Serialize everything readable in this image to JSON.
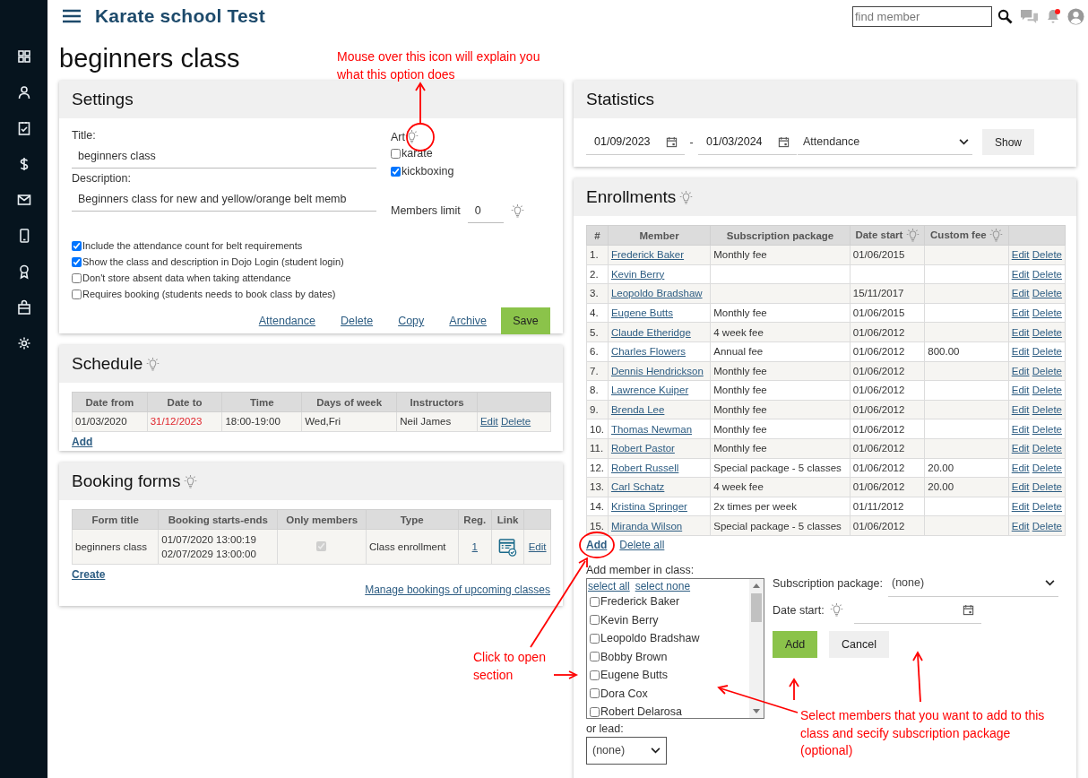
{
  "app": {
    "title": "Karate school Test",
    "search": {
      "placeholder": "find member"
    },
    "unread_notifications": true
  },
  "page_title": "beginners class",
  "settings": {
    "header": "Settings",
    "title_label": "Title:",
    "title_value": "beginners class",
    "description_label": "Description:",
    "description_value": "Beginners class for new and yellow/orange belt memb",
    "art_label": "Art",
    "art_hint": true,
    "arts": [
      {
        "label": "karate",
        "checked": false
      },
      {
        "label": "kickboxing",
        "checked": true
      }
    ],
    "members_limit_label": "Members limit",
    "members_limit_value": "0",
    "members_limit_hint": true,
    "options": [
      {
        "label": "Include the attendance count for belt requirements",
        "checked": true
      },
      {
        "label": "Show the class and description in Dojo Login (student login)",
        "checked": true
      },
      {
        "label": "Don't store absent data when taking attendance",
        "checked": false
      },
      {
        "label": "Requires booking (students needs to book class by dates)",
        "checked": false
      }
    ],
    "links": [
      "Attendance",
      "Delete",
      "Copy",
      "Archive"
    ],
    "save": "Save"
  },
  "schedule": {
    "header": "Schedule",
    "hint": true,
    "columns": [
      "Date from",
      "Date to",
      "Time",
      "Days of week",
      "Instructors"
    ],
    "rows": [
      {
        "date_from": "01/03/2020",
        "date_to": "31/12/2023",
        "date_to_expired": true,
        "time": "18:00-19:00",
        "days": "Wed,Fri",
        "instructors": "Neil James",
        "actions": [
          "Edit",
          "Delete"
        ]
      }
    ],
    "add": "Add"
  },
  "booking_forms": {
    "header": "Booking forms",
    "hint": true,
    "columns": [
      "Form title",
      "Booking starts-ends",
      "Only members",
      "Type",
      "Reg.",
      "Link"
    ],
    "rows": [
      {
        "form_title": "beginners class",
        "starts": "01/07/2020 13:00:19",
        "ends": "02/07/2029 13:00:00",
        "only_members": {
          "checked": true,
          "disabled": true
        },
        "type": "Class enrollment",
        "reg": "1",
        "actions": [
          "Edit"
        ]
      }
    ],
    "create": "Create",
    "manage": "Manage bookings of upcoming classes"
  },
  "statistics": {
    "header": "Statistics",
    "date_from": "01/09/2023",
    "separator": "-",
    "date_to": "01/03/2024",
    "report": "Attendance",
    "show": "Show"
  },
  "enrollments": {
    "header": "Enrollments",
    "hint": true,
    "columns": [
      {
        "label": "#"
      },
      {
        "label": "Member"
      },
      {
        "label": "Subscription package"
      },
      {
        "label": "Date start",
        "hint": true
      },
      {
        "label": "Custom fee",
        "hint": true
      }
    ],
    "rows": [
      {
        "n": "1.",
        "member": "Frederick Baker",
        "package": "Monthly fee",
        "date_start": "01/06/2015",
        "actions": [
          "Edit",
          "Delete"
        ]
      },
      {
        "n": "2.",
        "member": "Kevin Berry",
        "actions": [
          "Edit",
          "Delete"
        ]
      },
      {
        "n": "3.",
        "member": "Leopoldo Bradshaw",
        "date_start": "15/11/2017",
        "actions": [
          "Edit",
          "Delete"
        ]
      },
      {
        "n": "4.",
        "member": "Eugene Butts",
        "package": "Monthly fee",
        "date_start": "01/06/2015",
        "actions": [
          "Edit",
          "Delete"
        ]
      },
      {
        "n": "5.",
        "member": "Claude Etheridge",
        "package": "4 week fee",
        "date_start": "01/06/2012",
        "actions": [
          "Edit",
          "Delete"
        ]
      },
      {
        "n": "6.",
        "member": "Charles Flowers",
        "package": "Annual fee",
        "date_start": "01/06/2012",
        "custom_fee": "800.00",
        "actions": [
          "Edit",
          "Delete"
        ]
      },
      {
        "n": "7.",
        "member": "Dennis Hendrickson",
        "package": "Monthly fee",
        "date_start": "01/06/2012",
        "actions": [
          "Edit",
          "Delete"
        ]
      },
      {
        "n": "8.",
        "member": "Lawrence Kuiper",
        "package": "Monthly fee",
        "date_start": "01/06/2012",
        "actions": [
          "Edit",
          "Delete"
        ]
      },
      {
        "n": "9.",
        "member": "Brenda Lee",
        "package": "Monthly fee",
        "date_start": "01/06/2012",
        "actions": [
          "Edit",
          "Delete"
        ]
      },
      {
        "n": "10.",
        "member": "Thomas Newman",
        "package": "Monthly fee",
        "date_start": "01/06/2012",
        "actions": [
          "Edit",
          "Delete"
        ]
      },
      {
        "n": "11.",
        "member": "Robert Pastor",
        "package": "Monthly fee",
        "date_start": "01/06/2012",
        "actions": [
          "Edit",
          "Delete"
        ]
      },
      {
        "n": "12.",
        "member": "Robert Russell",
        "package": "Special package - 5 classes",
        "date_start": "01/06/2012",
        "custom_fee": "20.00",
        "actions": [
          "Edit",
          "Delete"
        ]
      },
      {
        "n": "13.",
        "member": "Carl Schatz",
        "package": "4 week fee",
        "date_start": "01/06/2012",
        "custom_fee": "20.00",
        "actions": [
          "Edit",
          "Delete"
        ]
      },
      {
        "n": "14.",
        "member": "Kristina Springer",
        "package": "2x times per week",
        "date_start": "01/11/2012",
        "actions": [
          "Edit",
          "Delete"
        ]
      },
      {
        "n": "15.",
        "member": "Miranda Wilson",
        "package": "Special package - 5 classes",
        "date_start": "01/06/2012",
        "actions": [
          "Edit",
          "Delete"
        ]
      }
    ],
    "add": "Add",
    "delete_all": "Delete all",
    "add_form": {
      "label": "Add member in class:",
      "select_all": "select all",
      "select_none": "select none",
      "members": [
        {
          "name": "Frederick Baker",
          "checked": false
        },
        {
          "name": "Kevin Berry",
          "checked": false
        },
        {
          "name": "Leopoldo Bradshaw",
          "checked": false
        },
        {
          "name": "Bobby Brown",
          "checked": false
        },
        {
          "name": "Eugene Butts",
          "checked": false
        },
        {
          "name": "Dora Cox",
          "checked": false
        },
        {
          "name": "Robert Delarosa",
          "checked": false
        }
      ],
      "lead_label": "or lead:",
      "lead_value": "(none)",
      "package_label": "Subscription package:",
      "package_value": "(none)",
      "date_label": "Date start:",
      "date_hint": true,
      "add": "Add",
      "cancel": "Cancel"
    }
  },
  "annotations": [
    {
      "text": "Mouse over this icon will explain you what this option does"
    },
    {
      "text": "Click to open section"
    },
    {
      "text": "Select members that you want to add to this class and secify subscription package (optional)"
    }
  ]
}
